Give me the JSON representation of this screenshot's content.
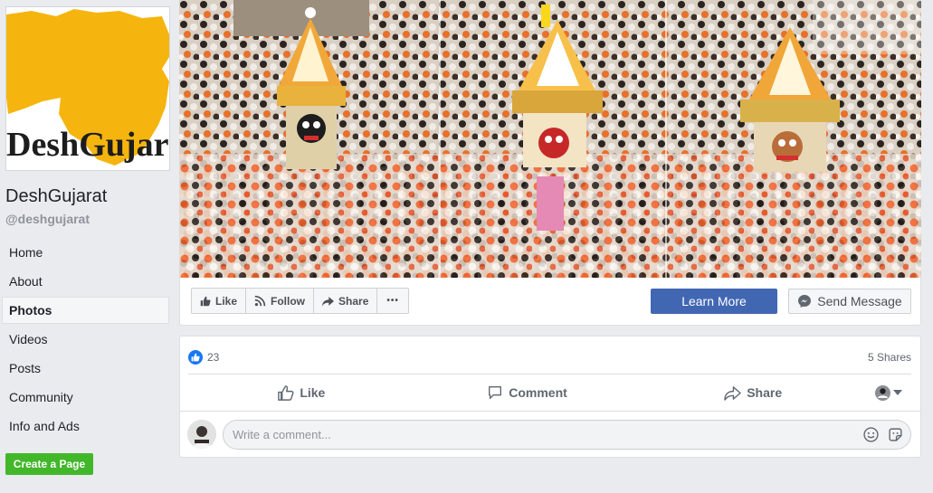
{
  "page": {
    "name": "DeshGujarat",
    "handle": "@deshgujarat",
    "logo_text": "DeshGujarat"
  },
  "nav": {
    "items": [
      {
        "label": "Home"
      },
      {
        "label": "About"
      },
      {
        "label": "Photos"
      },
      {
        "label": "Videos"
      },
      {
        "label": "Posts"
      },
      {
        "label": "Community"
      },
      {
        "label": "Info and Ads"
      }
    ],
    "active": "Photos"
  },
  "create_page_label": "Create a Page",
  "action_bar": {
    "like_label": "Like",
    "follow_label": "Follow",
    "share_label": "Share",
    "more_label": "•••",
    "learn_more_label": "Learn More",
    "send_message_label": "Send Message"
  },
  "post": {
    "reaction_count": "23",
    "shares_label": "5 Shares",
    "like_label": "Like",
    "comment_label": "Comment",
    "share_label": "Share",
    "comment_placeholder": "Write a comment..."
  },
  "colors": {
    "primary": "#4267b2",
    "green": "#42b72a",
    "logo_yellow": "#f5b50e",
    "page_bg": "#e9ebee"
  },
  "icons": [
    "thumbs-up-icon",
    "rss-icon",
    "share-arrow-icon",
    "more-icon",
    "messenger-icon",
    "comment-icon",
    "avatar-icon",
    "chevron-down-icon",
    "smiley-icon",
    "sticker-icon"
  ]
}
